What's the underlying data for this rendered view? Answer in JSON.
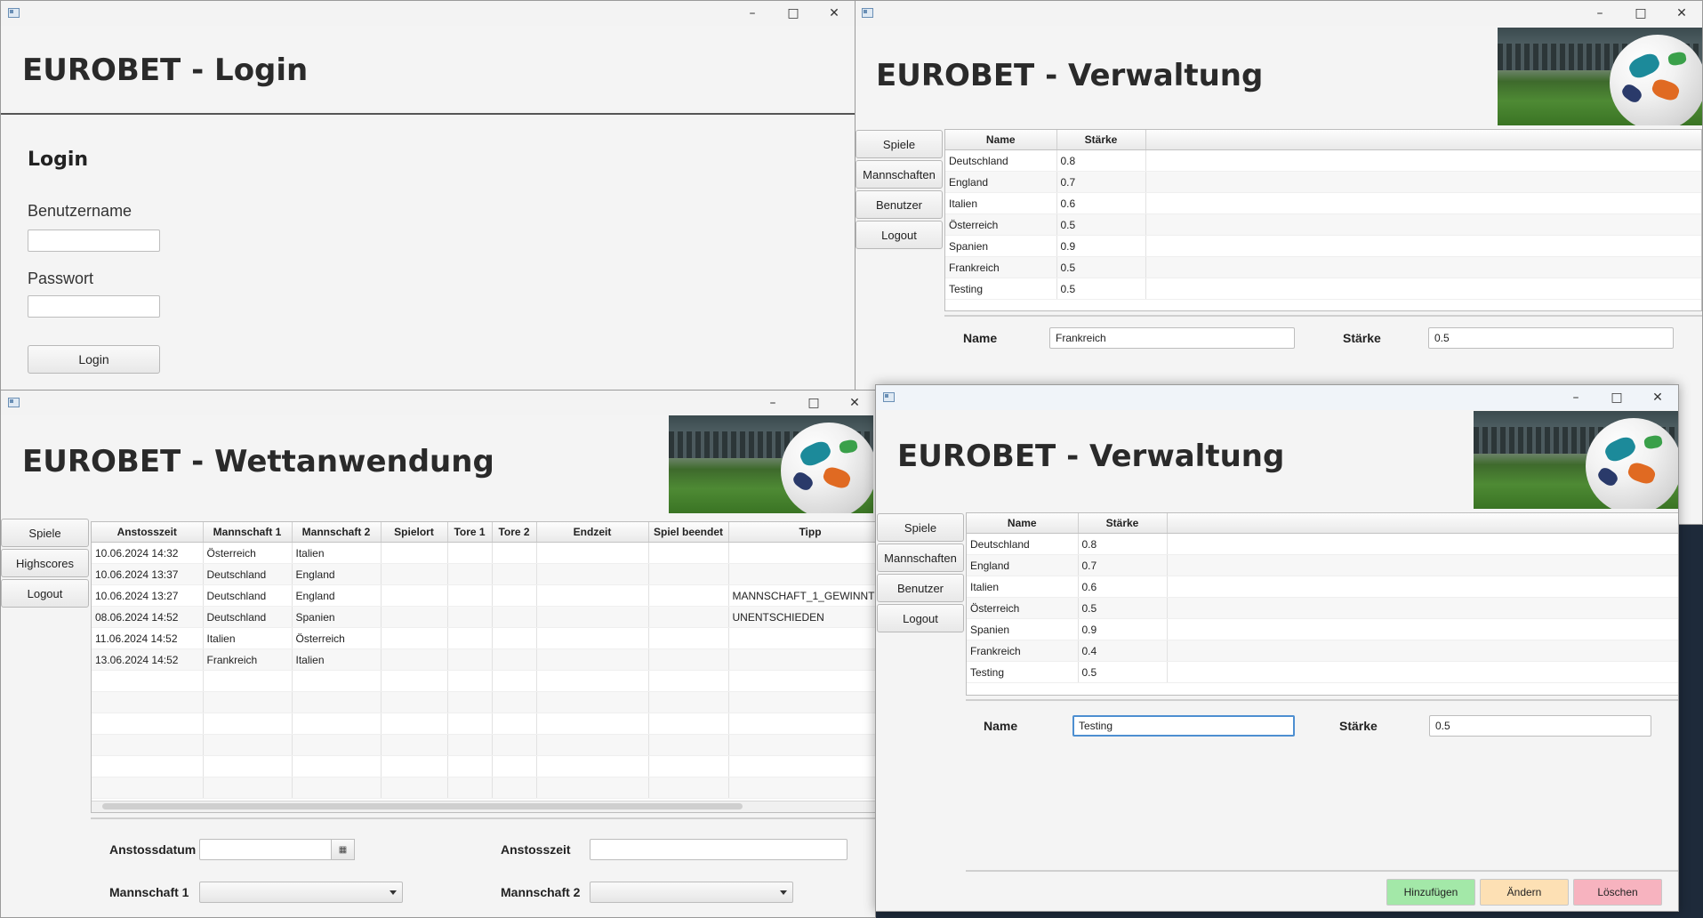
{
  "login_window": {
    "title": "EUROBET - Login",
    "section_title": "Login",
    "username_label": "Benutzername",
    "username_value": "",
    "password_label": "Passwort",
    "password_value": "",
    "login_button": "Login"
  },
  "bet_window": {
    "title": "EUROBET - Wettanwendung",
    "nav": [
      "Spiele",
      "Highscores",
      "Logout"
    ],
    "columns": [
      "Anstosszeit",
      "Mannschaft 1",
      "Mannschaft 2",
      "Spielort",
      "Tore 1",
      "Tore 2",
      "Endzeit",
      "Spiel beendet",
      "Tipp"
    ],
    "rows": [
      [
        "10.06.2024 14:32",
        "Österreich",
        "Italien",
        "",
        "",
        "",
        "",
        "",
        ""
      ],
      [
        "10.06.2024 13:37",
        "Deutschland",
        "England",
        "",
        "",
        "",
        "",
        "",
        ""
      ],
      [
        "10.06.2024 13:27",
        "Deutschland",
        "England",
        "",
        "",
        "",
        "",
        "",
        "MANNSCHAFT_1_GEWINNT"
      ],
      [
        "08.06.2024 14:52",
        "Deutschland",
        "Spanien",
        "",
        "",
        "",
        "",
        "",
        "UNENTSCHIEDEN"
      ],
      [
        "11.06.2024 14:52",
        "Italien",
        "Österreich",
        "",
        "",
        "",
        "",
        "",
        ""
      ],
      [
        "13.06.2024 14:52",
        "Frankreich",
        "Italien",
        "",
        "",
        "",
        "",
        "",
        ""
      ]
    ],
    "form": {
      "date_label": "Anstossdatum",
      "date_value": "",
      "time_label": "Anstosszeit",
      "time_value": "",
      "team1_label": "Mannschaft 1",
      "team1_value": "",
      "team2_label": "Mannschaft 2",
      "team2_value": ""
    }
  },
  "admin_back": {
    "title": "EUROBET - Verwaltung",
    "nav": [
      "Spiele",
      "Mannschaften",
      "Benutzer",
      "Logout"
    ],
    "columns": [
      "Name",
      "Stärke"
    ],
    "rows": [
      [
        "Deutschland",
        "0.8"
      ],
      [
        "England",
        "0.7"
      ],
      [
        "Italien",
        "0.6"
      ],
      [
        "Österreich",
        "0.5"
      ],
      [
        "Spanien",
        "0.9"
      ],
      [
        "Frankreich",
        "0.5"
      ],
      [
        "Testing",
        "0.5"
      ]
    ],
    "form": {
      "name_label": "Name",
      "name_value": "Frankreich",
      "strength_label": "Stärke",
      "strength_value": "0.5"
    }
  },
  "admin_front": {
    "title": "EUROBET - Verwaltung",
    "nav": [
      "Spiele",
      "Mannschaften",
      "Benutzer",
      "Logout"
    ],
    "columns": [
      "Name",
      "Stärke"
    ],
    "rows": [
      [
        "Deutschland",
        "0.8"
      ],
      [
        "England",
        "0.7"
      ],
      [
        "Italien",
        "0.6"
      ],
      [
        "Österreich",
        "0.5"
      ],
      [
        "Spanien",
        "0.9"
      ],
      [
        "Frankreich",
        "0.4"
      ],
      [
        "Testing",
        "0.5"
      ]
    ],
    "form": {
      "name_label": "Name",
      "name_value": "Testing",
      "strength_label": "Stärke",
      "strength_value": "0.5"
    },
    "buttons": {
      "add": "Hinzufügen",
      "edit": "Ändern",
      "delete": "Löschen"
    }
  },
  "colors": {
    "add": "#a3e8a8",
    "edit": "#fde0b4",
    "delete": "#f7b3bf",
    "focus": "#4d8fd1"
  },
  "icons": [
    "app-window-icon",
    "minimize-icon",
    "maximize-icon",
    "close-icon",
    "calendar-icon",
    "chevron-down-icon"
  ]
}
